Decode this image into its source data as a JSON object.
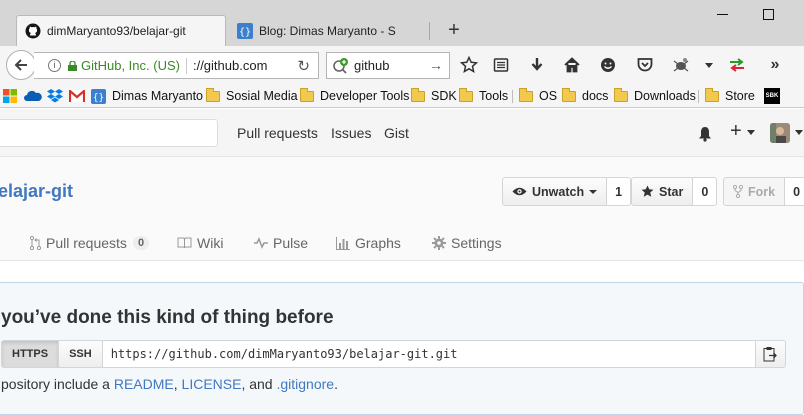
{
  "browser": {
    "tabs": [
      {
        "title": "dimMaryanto93/belajar-git",
        "favicon": "github-octocat-icon",
        "active": true
      },
      {
        "title": "Blog: Dimas Maryanto - S",
        "favicon": "braces-icon",
        "active": false
      }
    ],
    "url": {
      "org_label": "GitHub, Inc. (US)",
      "address": "://github.com"
    },
    "search": {
      "value": "github"
    },
    "bookmarks": [
      {
        "label": "",
        "icon": "windows-flag-icon"
      },
      {
        "label": "",
        "icon": "onedrive-cloud-icon"
      },
      {
        "label": "",
        "icon": "dropbox-icon"
      },
      {
        "label": "",
        "icon": "gmail-icon"
      },
      {
        "label": "Dimas Maryanto",
        "icon": "braces-icon"
      },
      {
        "label": "Sosial Media",
        "icon": "folder-icon"
      },
      {
        "label": "Developer Tools",
        "icon": "folder-icon"
      },
      {
        "label": "SDK",
        "icon": "folder-icon"
      },
      {
        "label": "Tools",
        "icon": "folder-icon"
      },
      {
        "label": "OS",
        "icon": "folder-icon"
      },
      {
        "label": "docs",
        "icon": "folder-icon"
      },
      {
        "label": "Downloads",
        "icon": "folder-icon"
      },
      {
        "label": "Store",
        "icon": "folder-icon"
      },
      {
        "label": "SBK",
        "icon": "sbk-logo-icon"
      }
    ]
  },
  "github": {
    "nav": {
      "pull_requests": "Pull requests",
      "issues": "Issues",
      "gist": "Gist"
    },
    "repo": {
      "name": "elajar-git",
      "watch_label": "Unwatch",
      "watch_count": "1",
      "star_label": "Star",
      "star_count": "0",
      "fork_label": "Fork",
      "fork_count": "0"
    },
    "tabs": {
      "pull_requests": "Pull requests",
      "pull_requests_count": "0",
      "wiki": "Wiki",
      "pulse": "Pulse",
      "graphs": "Graphs",
      "settings": "Settings"
    },
    "quick_setup": {
      "title": "you’ve done this kind of thing before",
      "https_label": "HTTPS",
      "ssh_label": "SSH",
      "clone_url": "https://github.com/dimMaryanto93/belajar-git.git",
      "desc_prefix": "pository include a ",
      "readme": "README",
      "sep1": ", ",
      "license": "LICENSE",
      "sep2": ", and ",
      "gitignore": ".gitignore",
      "desc_suffix": "."
    }
  },
  "colors": {
    "accent_link": "#4078c0",
    "secure_green": "#3a8a27",
    "chrome_bg": "#d6d6d6"
  }
}
